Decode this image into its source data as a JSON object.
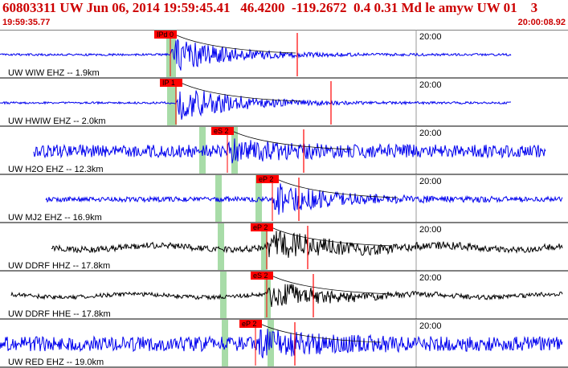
{
  "header": {
    "title": "60803311 UW Jun 06, 2014 19:59:45.41   46.4200  -119.2672  0.4 0.31 Md le amyw UW 01    3",
    "start_time": "19:59:35.77",
    "end_time": "20:00:08.92"
  },
  "minute_label": "20:00",
  "colors": {
    "header_red": "#cc0000",
    "blue": "#0000ee",
    "black": "#000000",
    "pick_green": "#a8dca8",
    "pick_red": "#ff0000",
    "axis_gray": "#999999"
  },
  "traces": [
    {
      "label": "UW WIW EHZ -- 1.9km",
      "color": "blue",
      "start_frac": 0.0,
      "end_frac": 0.9,
      "onset_frac": 0.3,
      "pick_label": "IPd 0",
      "amp": 0.85,
      "noise": 0.05,
      "wander": 0
    },
    {
      "label": "UW HWIW EHZ -- 2.0km",
      "color": "blue",
      "start_frac": 0.0,
      "end_frac": 0.9,
      "onset_frac": 0.31,
      "pick_label": "IP 1",
      "amp": 0.9,
      "noise": 0.05,
      "wander": 0
    },
    {
      "label": "UW H2O EHZ -- 12.3km",
      "color": "blue",
      "start_frac": 0.06,
      "end_frac": 0.96,
      "onset_frac": 0.4,
      "pick_label": "eS 2",
      "amp": 0.4,
      "noise": 0.3,
      "wander": 0
    },
    {
      "label": "UW MJ2 EHZ -- 16.9km",
      "color": "blue",
      "start_frac": 0.08,
      "end_frac": 0.99,
      "onset_frac": 0.48,
      "pick_label": "eP 2",
      "amp": 0.75,
      "noise": 0.12,
      "wander": 0
    },
    {
      "label": "UW DDRF HHZ -- 17.8km",
      "color": "black",
      "start_frac": 0.09,
      "end_frac": 0.99,
      "onset_frac": 0.47,
      "pick_label": "eP 2",
      "amp": 0.75,
      "noise": 0.15,
      "wander": 0.35
    },
    {
      "label": "UW DDRF HHE -- 17.8km",
      "color": "black",
      "start_frac": 0.02,
      "end_frac": 0.99,
      "onset_frac": 0.47,
      "pick_label": "eS 2",
      "amp": 0.65,
      "noise": 0.1,
      "wander": 0.25
    },
    {
      "label": "UW RED EHZ -- 19.0km",
      "color": "blue",
      "start_frac": 0.0,
      "end_frac": 0.99,
      "onset_frac": 0.45,
      "pick_label": "eP 2",
      "amp": 0.5,
      "noise": 0.35,
      "wander": 0
    }
  ]
}
